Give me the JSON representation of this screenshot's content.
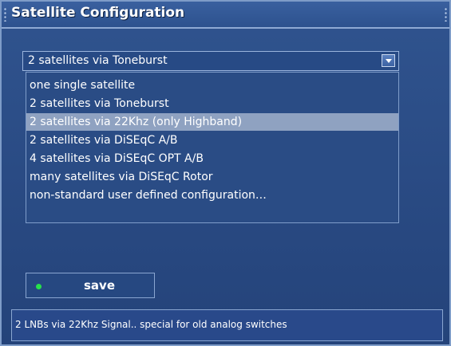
{
  "window": {
    "title": "Satellite Configuration"
  },
  "combo": {
    "value": "2 satellites via Toneburst"
  },
  "dropdown": {
    "selected_index": 2,
    "options": [
      "one single satellite",
      "2 satellites via Toneburst",
      "2 satellites via 22Khz (only Highband)",
      "2 satellites via DiSEqC A/B",
      "4 satellites via DiSEqC OPT A/B",
      "many satellites via DiSEqC Rotor",
      "non-standard user defined configuration…"
    ]
  },
  "save_button": {
    "label": "save",
    "indicator_color": "#27e24a"
  },
  "status": {
    "text": "2 LNBs via 22Khz Signal.. special for old analog switches"
  },
  "colors": {
    "background": "#2a4b84",
    "selection": "#8fa2c1"
  }
}
